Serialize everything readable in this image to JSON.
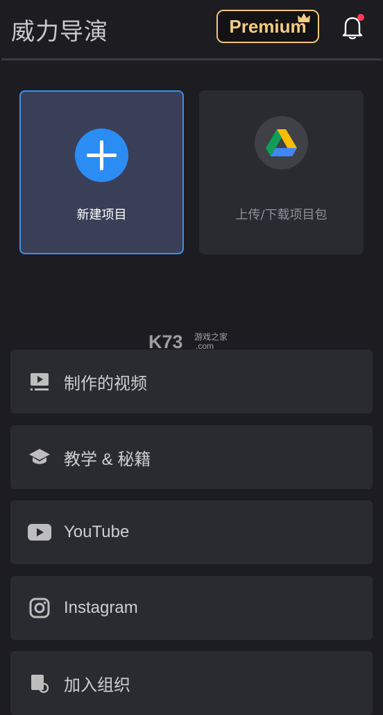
{
  "header": {
    "title": "威力导演",
    "premium_label": "Premium",
    "notification_dot_color": "#ff3b57"
  },
  "tiles": {
    "new_project": {
      "label": "新建项目",
      "icon": "plus-icon",
      "accent": "#2b8cf4"
    },
    "drive": {
      "label": "上传/下载项目包",
      "icon": "google-drive-icon"
    }
  },
  "watermark": {
    "text": "K73",
    "sub1": "游戏之家",
    "sub2": ".com"
  },
  "menu": [
    {
      "label": "制作的视频",
      "icon": "video-library-icon"
    },
    {
      "label": "教学 & 秘籍",
      "icon": "graduation-cap-icon"
    },
    {
      "label": "YouTube",
      "icon": "youtube-icon"
    },
    {
      "label": "Instagram",
      "icon": "instagram-icon"
    },
    {
      "label": "加入组织",
      "icon": "join-group-icon"
    }
  ]
}
